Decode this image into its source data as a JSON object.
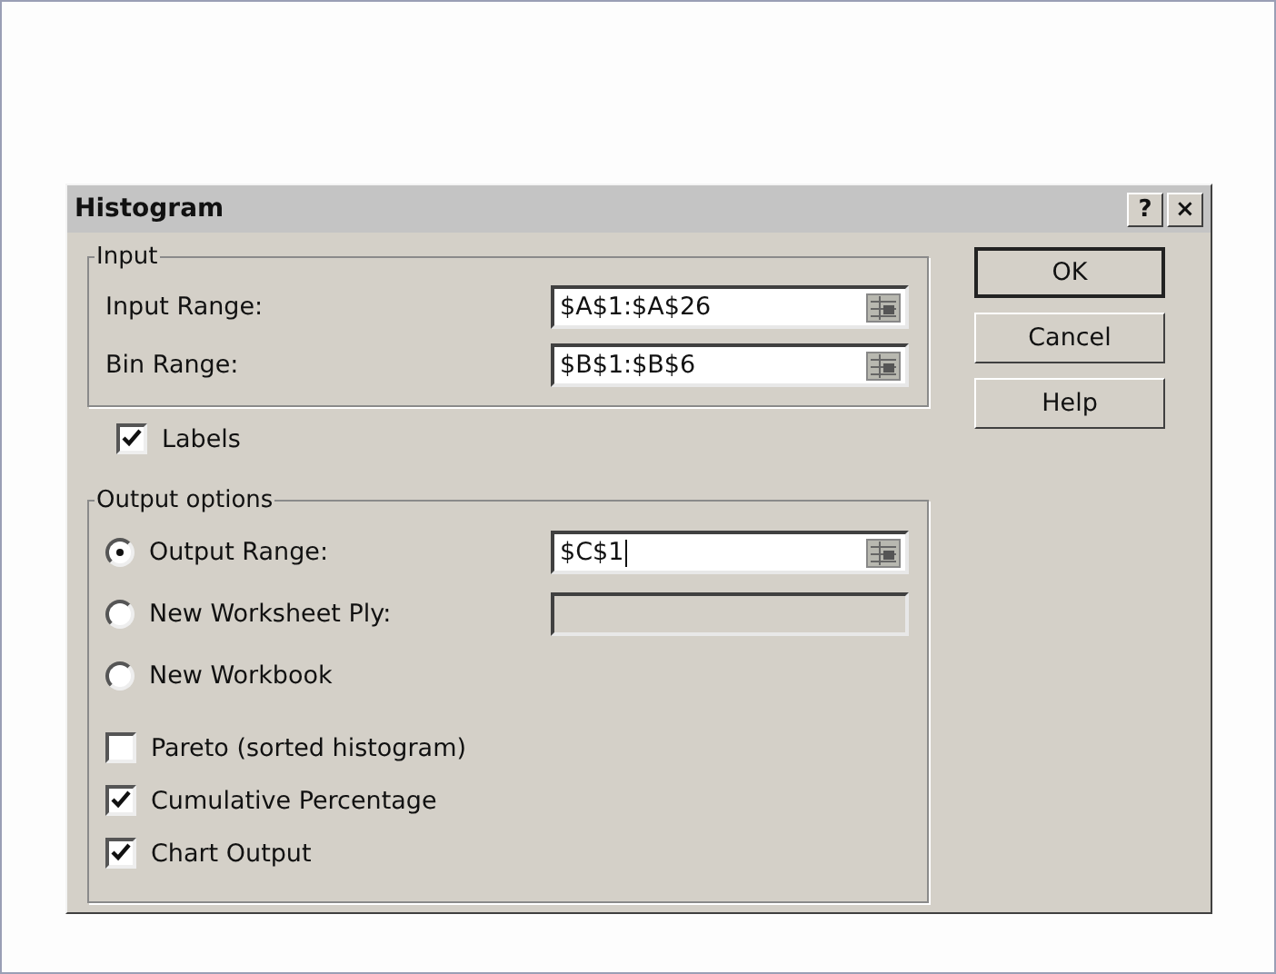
{
  "window": {
    "title": "Histogram",
    "title_buttons": [
      "?",
      "×"
    ]
  },
  "input_group": {
    "legend": "Input",
    "fields": [
      {
        "label": "Input Range:",
        "value": "$A$1:$A$26"
      },
      {
        "label": "Bin Range:",
        "value": "$B$1:$B$6"
      }
    ]
  },
  "labels_checkbox": {
    "label": "Labels",
    "checked": true
  },
  "output_group": {
    "legend": "Output options",
    "radios": [
      {
        "label": "Output Range:",
        "selected": true,
        "value": "$C$1",
        "disabled": false,
        "focused": true
      },
      {
        "label": "New Worksheet Ply:",
        "selected": false,
        "disabled": true
      },
      {
        "label": "New Workbook",
        "selected": false
      }
    ],
    "checkboxes": [
      {
        "label": "Pareto (sorted histogram)",
        "checked": false
      },
      {
        "label": "Cumulative Percentage",
        "checked": true
      },
      {
        "label": "Chart Output",
        "checked": true
      }
    ]
  },
  "buttons": [
    {
      "label": "OK",
      "default": true
    },
    {
      "label": "Cancel",
      "default": false
    },
    {
      "label": "Help",
      "default": false
    }
  ]
}
